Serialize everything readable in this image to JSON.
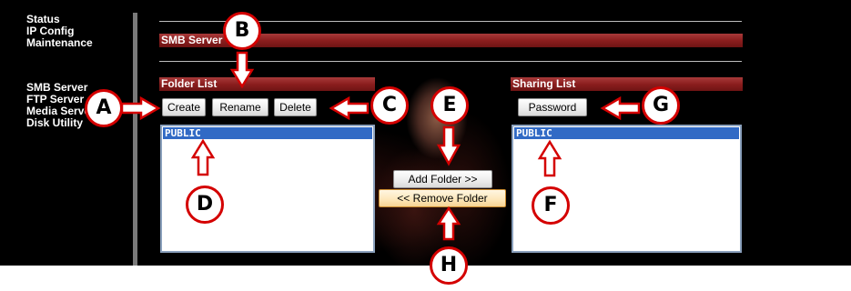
{
  "nav": {
    "items": [
      {
        "label": "Status"
      },
      {
        "label": "IP Config"
      },
      {
        "label": "Maintenance"
      },
      {
        "label": "SMB Server"
      },
      {
        "label": "FTP Server"
      },
      {
        "label": "Media Server"
      },
      {
        "label": "Disk Utility"
      }
    ]
  },
  "page": {
    "section_title": "SMB Server"
  },
  "folder_list": {
    "title": "Folder List",
    "buttons": {
      "create": "Create",
      "rename": "Rename",
      "delete": "Delete"
    },
    "items": [
      "PUBLIC"
    ]
  },
  "middle": {
    "add_folder": "Add Folder >>",
    "remove_folder": "<< Remove Folder"
  },
  "sharing_list": {
    "title": "Sharing List",
    "password_button": "Password",
    "items": [
      "PUBLIC"
    ]
  },
  "callouts": {
    "a": "A",
    "b": "B",
    "c": "C",
    "d": "D",
    "e": "E",
    "f": "F",
    "g": "G",
    "h": "H"
  },
  "colors": {
    "background": "#000000",
    "section_bar": "#8b1e1e",
    "selection": "#316ac5",
    "callout_border": "#d40000",
    "button_highlight": "#fde6b8"
  }
}
